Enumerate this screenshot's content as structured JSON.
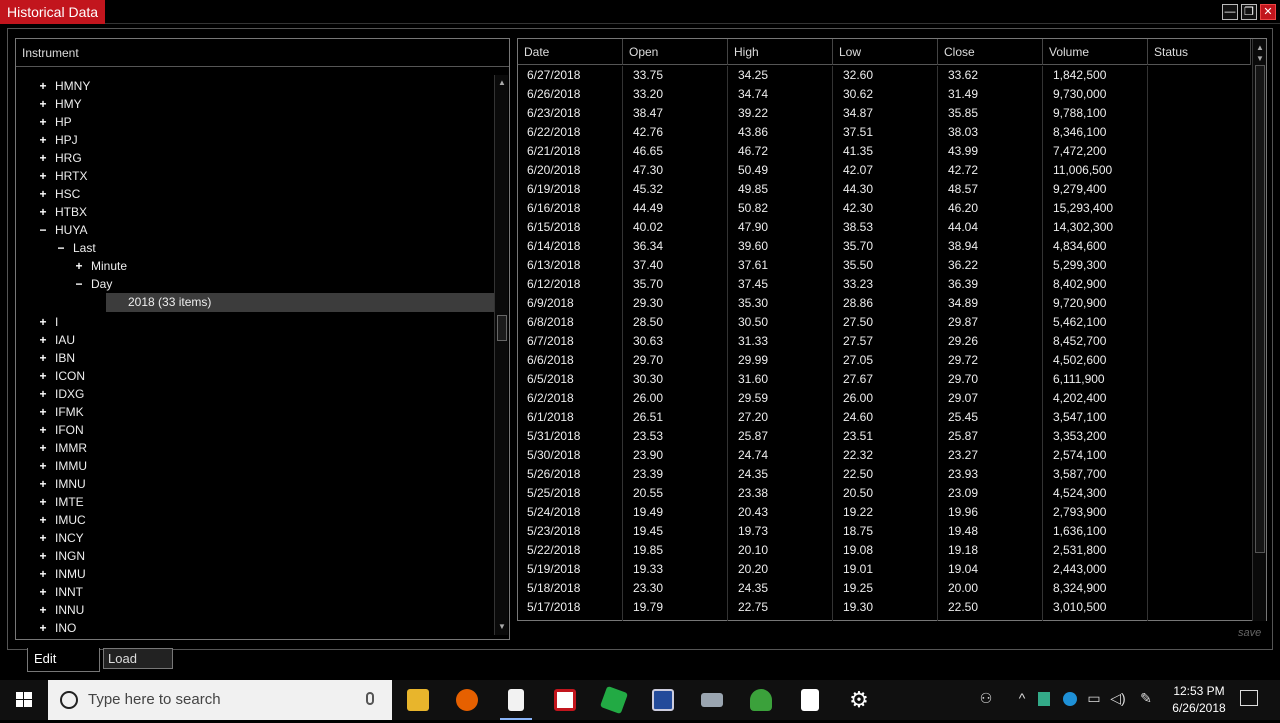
{
  "window": {
    "title": "Historical Data",
    "minimize": "—",
    "maximize": "❐",
    "close": "✕"
  },
  "instrument_panel": {
    "header": "Instrument",
    "tree": [
      {
        "label": "HMNY",
        "sign": "+",
        "level": 0
      },
      {
        "label": "HMY",
        "sign": "+",
        "level": 0
      },
      {
        "label": "HP",
        "sign": "+",
        "level": 0
      },
      {
        "label": "HPJ",
        "sign": "+",
        "level": 0
      },
      {
        "label": "HRG",
        "sign": "+",
        "level": 0
      },
      {
        "label": "HRTX",
        "sign": "+",
        "level": 0
      },
      {
        "label": "HSC",
        "sign": "+",
        "level": 0
      },
      {
        "label": "HTBX",
        "sign": "+",
        "level": 0
      },
      {
        "label": "HUYA",
        "sign": "−",
        "level": 0
      },
      {
        "label": "Last",
        "sign": "−",
        "level": 1
      },
      {
        "label": "Minute",
        "sign": "+",
        "level": 2
      },
      {
        "label": "Day",
        "sign": "−",
        "level": 2
      }
    ],
    "selected": "2018 (33 items)",
    "tree_after": [
      "I",
      "IAU",
      "IBN",
      "ICON",
      "IDXG",
      "IFMK",
      "IFON",
      "IMMR",
      "IMMU",
      "IMNU",
      "IMTE",
      "IMUC",
      "INCY",
      "INGN",
      "INMU",
      "INNT",
      "INNU",
      "INO"
    ]
  },
  "table": {
    "columns": [
      "Date",
      "Open",
      "High",
      "Low",
      "Close",
      "Volume",
      "Status"
    ],
    "rows": [
      [
        "6/27/2018",
        "33.75",
        "34.25",
        "32.60",
        "33.62",
        "1,842,500"
      ],
      [
        "6/26/2018",
        "33.20",
        "34.74",
        "30.62",
        "31.49",
        "9,730,000"
      ],
      [
        "6/23/2018",
        "38.47",
        "39.22",
        "34.87",
        "35.85",
        "9,788,100"
      ],
      [
        "6/22/2018",
        "42.76",
        "43.86",
        "37.51",
        "38.03",
        "8,346,100"
      ],
      [
        "6/21/2018",
        "46.65",
        "46.72",
        "41.35",
        "43.99",
        "7,472,200"
      ],
      [
        "6/20/2018",
        "47.30",
        "50.49",
        "42.07",
        "42.72",
        "11,006,500"
      ],
      [
        "6/19/2018",
        "45.32",
        "49.85",
        "44.30",
        "48.57",
        "9,279,400"
      ],
      [
        "6/16/2018",
        "44.49",
        "50.82",
        "42.30",
        "46.20",
        "15,293,400"
      ],
      [
        "6/15/2018",
        "40.02",
        "47.90",
        "38.53",
        "44.04",
        "14,302,300"
      ],
      [
        "6/14/2018",
        "36.34",
        "39.60",
        "35.70",
        "38.94",
        "4,834,600"
      ],
      [
        "6/13/2018",
        "37.40",
        "37.61",
        "35.50",
        "36.22",
        "5,299,300"
      ],
      [
        "6/12/2018",
        "35.70",
        "37.45",
        "33.23",
        "36.39",
        "8,402,900"
      ],
      [
        "6/9/2018",
        "29.30",
        "35.30",
        "28.86",
        "34.89",
        "9,720,900"
      ],
      [
        "6/8/2018",
        "28.50",
        "30.50",
        "27.50",
        "29.87",
        "5,462,100"
      ],
      [
        "6/7/2018",
        "30.63",
        "31.33",
        "27.57",
        "29.26",
        "8,452,700"
      ],
      [
        "6/6/2018",
        "29.70",
        "29.99",
        "27.05",
        "29.72",
        "4,502,600"
      ],
      [
        "6/5/2018",
        "30.30",
        "31.60",
        "27.67",
        "29.70",
        "6,111,900"
      ],
      [
        "6/2/2018",
        "26.00",
        "29.59",
        "26.00",
        "29.07",
        "4,202,400"
      ],
      [
        "6/1/2018",
        "26.51",
        "27.20",
        "24.60",
        "25.45",
        "3,547,100"
      ],
      [
        "5/31/2018",
        "23.53",
        "25.87",
        "23.51",
        "25.87",
        "3,353,200"
      ],
      [
        "5/30/2018",
        "23.90",
        "24.74",
        "22.32",
        "23.27",
        "2,574,100"
      ],
      [
        "5/26/2018",
        "23.39",
        "24.35",
        "22.50",
        "23.93",
        "3,587,700"
      ],
      [
        "5/25/2018",
        "20.55",
        "23.38",
        "20.50",
        "23.09",
        "4,524,300"
      ],
      [
        "5/24/2018",
        "19.49",
        "20.43",
        "19.22",
        "19.96",
        "2,793,900"
      ],
      [
        "5/23/2018",
        "19.45",
        "19.73",
        "18.75",
        "19.48",
        "1,636,100"
      ],
      [
        "5/22/2018",
        "19.85",
        "20.10",
        "19.08",
        "19.18",
        "2,531,800"
      ],
      [
        "5/19/2018",
        "19.33",
        "20.20",
        "19.01",
        "19.04",
        "2,443,000"
      ],
      [
        "5/18/2018",
        "23.30",
        "24.35",
        "19.25",
        "20.00",
        "8,324,900"
      ],
      [
        "5/17/2018",
        "19.79",
        "22.75",
        "19.30",
        "22.50",
        "3,010,500"
      ]
    ]
  },
  "save_label": "save",
  "tabs": {
    "edit": "Edit",
    "load": "Load"
  },
  "taskbar": {
    "search_placeholder": "Type here to search",
    "time": "12:53 PM",
    "date": "6/26/2018",
    "apps": [
      "file-explorer",
      "firefox",
      "notepad",
      "app-red",
      "app-green-shape",
      "app-network",
      "keyboard-app",
      "android-app",
      "sticky-note",
      "settings"
    ]
  },
  "colors": {
    "title_bar": "#c2151d",
    "background": "#000000",
    "selected_row": "#3c3c3c"
  }
}
